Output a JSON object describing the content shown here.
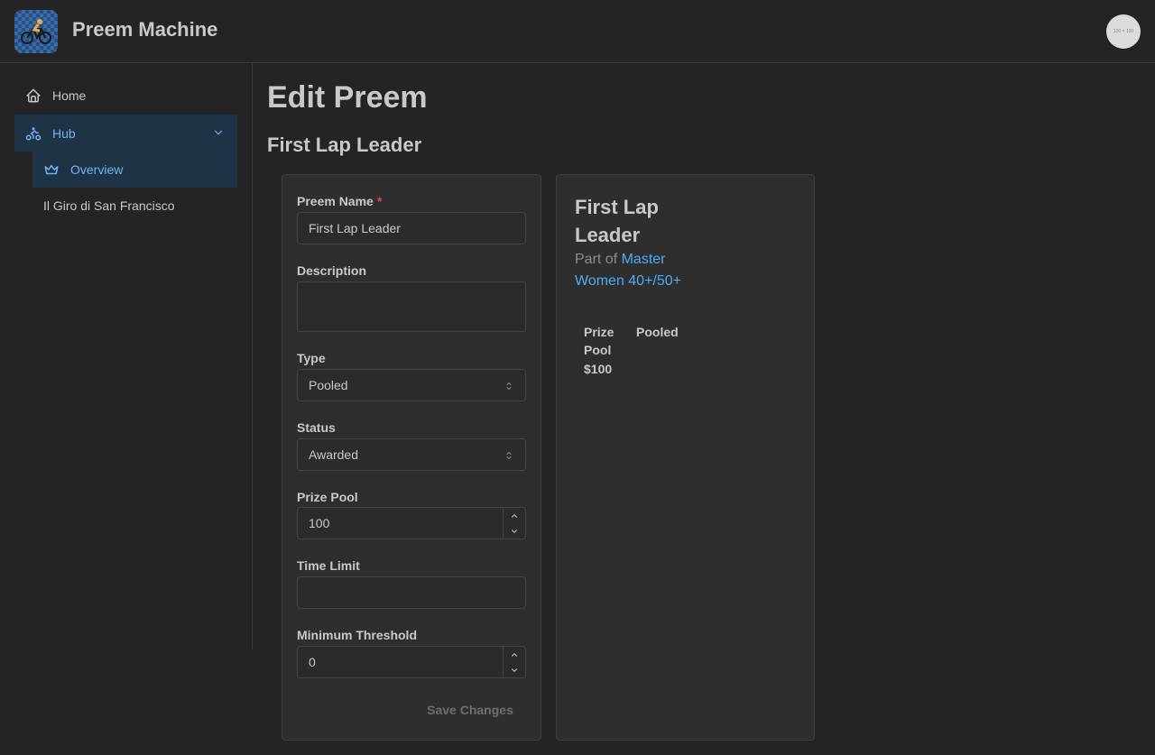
{
  "app": {
    "title": "Preem Machine",
    "avatar_text": "100 × 100"
  },
  "sidebar": {
    "items": [
      {
        "label": "Home",
        "icon": "home-icon"
      },
      {
        "label": "Hub",
        "icon": "bicycle-icon",
        "expanded": true
      },
      {
        "label": "Overview",
        "icon": "crown-icon",
        "active": true
      },
      {
        "label": "Il Giro di San Francisco"
      }
    ]
  },
  "main": {
    "title": "Edit Preem",
    "subtitle": "First Lap Leader"
  },
  "form": {
    "name_label": "Preem Name",
    "required_mark": "*",
    "name_value": "First Lap Leader",
    "description_label": "Description",
    "description_value": "",
    "type_label": "Type",
    "type_value": "Pooled",
    "status_label": "Status",
    "status_value": "Awarded",
    "prize_pool_label": "Prize Pool",
    "prize_pool_value": "100",
    "time_limit_label": "Time Limit",
    "time_limit_value": "",
    "min_threshold_label": "Minimum Threshold",
    "min_threshold_value": "0",
    "save_label": "Save Changes"
  },
  "preview": {
    "title": "First Lap Leader",
    "part_of_prefix": "Part of",
    "part_of_link": "Master Women 40+/50+",
    "prize_pool_label": "Prize Pool",
    "prize_pool_value": "$100",
    "type_value": "Pooled"
  },
  "colors": {
    "background": "#242424",
    "accent": "#4dabf7",
    "active_nav_bg": "#1f3347",
    "required": "#f03e3e"
  }
}
